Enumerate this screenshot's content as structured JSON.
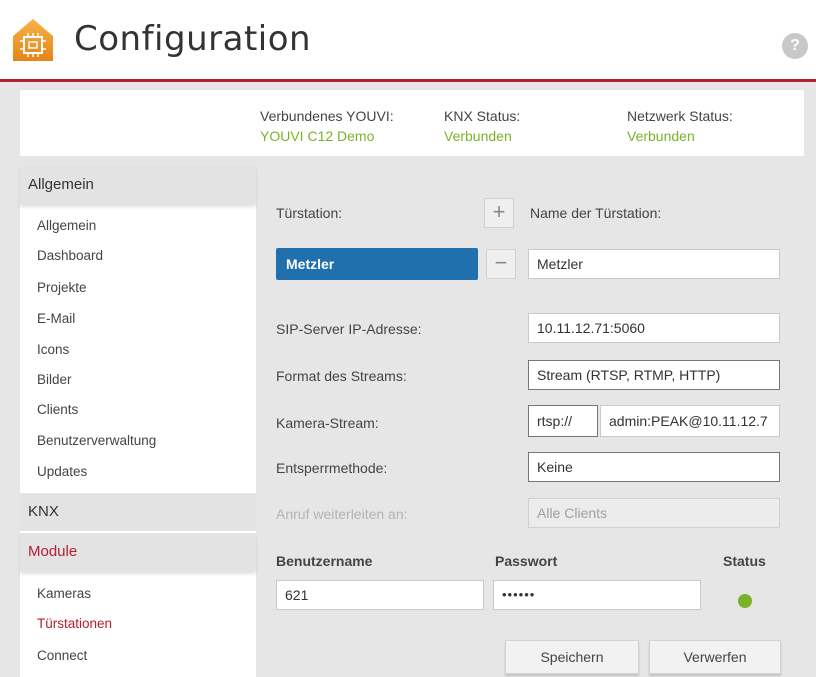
{
  "header": {
    "title": "Configuration",
    "help_label": "?",
    "accent_color": "#b5202e"
  },
  "status": {
    "youvi_label": "Verbundenes YOUVI:",
    "youvi_value": "YOUVI C12 Demo",
    "knx_label": "KNX Status:",
    "knx_value": "Verbunden",
    "network_label": "Netzwerk Status:",
    "network_value": "Verbunden",
    "ok_color": "#7ab32a"
  },
  "sidebar": {
    "sections": [
      {
        "label": "Allgemein",
        "items": [
          "Allgemein",
          "Dashboard",
          "Projekte",
          "E-Mail",
          "Icons",
          "Bilder",
          "Clients",
          "Benutzerverwaltung",
          "Updates"
        ]
      },
      {
        "label": "KNX",
        "items": []
      },
      {
        "label": "Module",
        "items": [
          "Kameras",
          "Türstationen",
          "Connect"
        ],
        "active_item": "Türstationen"
      }
    ]
  },
  "form": {
    "door_station_label": "Türstation:",
    "add_icon": "plus-icon",
    "remove_icon": "minus-icon",
    "selected_station": "Metzler",
    "name_label": "Name der Türstation:",
    "name_value": "Metzler",
    "sip_label": "SIP-Server IP-Adresse:",
    "sip_value": "10.11.12.71:5060",
    "stream_format_label": "Format des Streams:",
    "stream_format_value": "Stream (RTSP, RTMP, HTTP)",
    "camera_stream_label": "Kamera-Stream:",
    "camera_protocol": "rtsp://",
    "camera_url": "admin:PEAK@10.11.12.7",
    "unlock_label": "Entsperrmethode:",
    "unlock_value": "Keine",
    "forward_label": "Anruf weiterleiten an:",
    "forward_value": "Alle Clients",
    "username_header": "Benutzername",
    "password_header": "Passwort",
    "status_header": "Status",
    "username_value": "621",
    "password_value": "••••••",
    "save_label": "Speichern",
    "discard_label": "Verwerfen"
  }
}
